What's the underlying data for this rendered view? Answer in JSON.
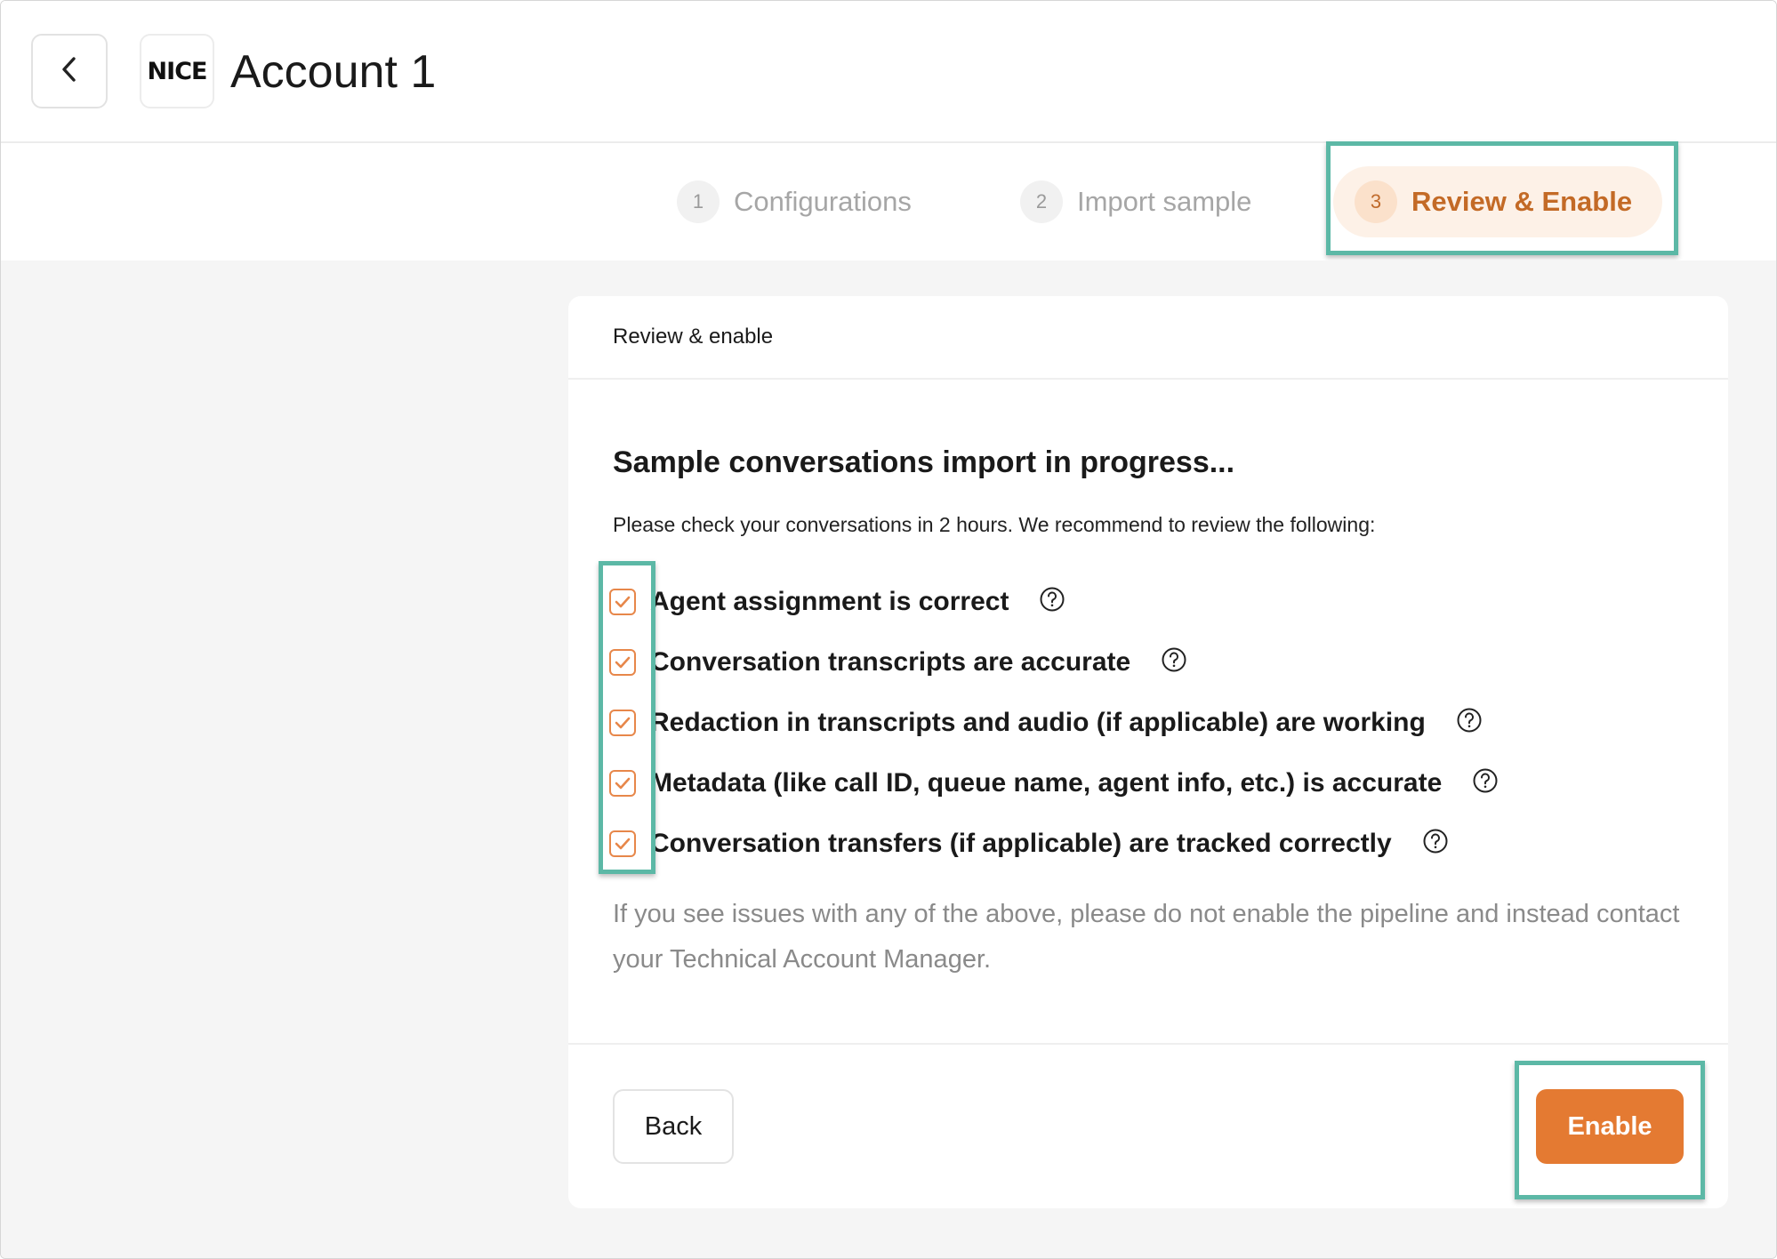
{
  "header": {
    "back_icon": "chevron-left-icon",
    "logo_text": "NICE",
    "title": "Account 1"
  },
  "stepper": {
    "steps": [
      {
        "number": "1",
        "label": "Configurations",
        "state": "inactive"
      },
      {
        "number": "2",
        "label": "Import sample",
        "state": "inactive"
      },
      {
        "number": "3",
        "label": "Review & Enable",
        "state": "active"
      }
    ]
  },
  "card": {
    "header_title": "Review & enable",
    "progress_title": "Sample conversations import in progress...",
    "progress_subtitle": "Please check your conversations in 2 hours. We recommend to review the following:",
    "checklist": [
      {
        "label": "Agent assignment is correct",
        "checked": true
      },
      {
        "label": "Conversation transcripts are accurate",
        "checked": true
      },
      {
        "label": "Redaction in transcripts and audio (if applicable) are working",
        "checked": true
      },
      {
        "label": "Metadata (like call ID, queue name, agent info, etc.) is accurate",
        "checked": true
      },
      {
        "label": "Conversation transfers (if applicable) are tracked correctly",
        "checked": true
      }
    ],
    "note": "If you see issues with any of the above, please do not enable the pipeline and instead contact your Technical Account Manager.",
    "back_label": "Back",
    "enable_label": "Enable"
  },
  "colors": {
    "accent": "#e47a32",
    "highlight": "#5cb8a6",
    "active_step_bg": "#fdf1e7"
  }
}
